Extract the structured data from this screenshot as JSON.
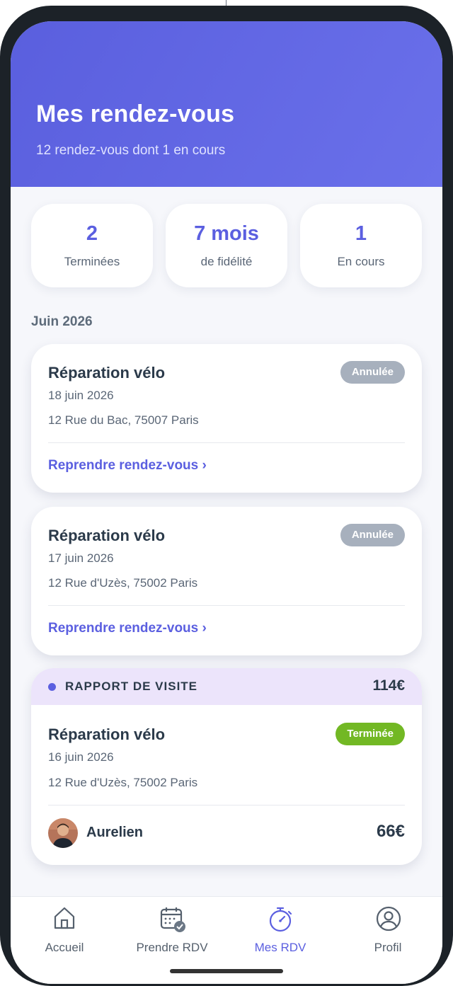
{
  "header": {
    "title": "Mes rendez-vous",
    "subtitle": "12 rendez-vous dont 1 en cours"
  },
  "stats": [
    {
      "value": "2",
      "label": "Terminées"
    },
    {
      "value": "7 mois",
      "label": "de fidélité"
    },
    {
      "value": "1",
      "label": "En cours"
    }
  ],
  "section": {
    "month": "Juin 2026"
  },
  "appointments": [
    {
      "title": "Réparation vélo",
      "date": "18 juin 2026",
      "address": "12 Rue du Bac, 75007 Paris",
      "status": "Annulée",
      "action": "Reprendre rendez-vous ›"
    },
    {
      "title": "Réparation vélo",
      "date": "17 juin 2026",
      "address": "12 Rue d'Uzès, 75002 Paris",
      "status": "Annulée",
      "action": "Reprendre rendez-vous ›"
    }
  ],
  "report": {
    "label": "RAPPORT DE VISITE",
    "total": "114€",
    "title": "Réparation vélo",
    "date": "16 juin 2026",
    "address": "12 Rue d'Uzès, 75002 Paris",
    "status": "Terminée",
    "person": "Aurelien",
    "price": "66€"
  },
  "tabs": [
    {
      "label": "Accueil",
      "icon": "home-icon"
    },
    {
      "label": "Prendre RDV",
      "icon": "calendar-check-icon"
    },
    {
      "label": "Mes RDV",
      "icon": "stopwatch-icon"
    },
    {
      "label": "Profil",
      "icon": "user-circle-icon"
    }
  ],
  "colors": {
    "accent": "#5b5fe0",
    "header_gradient_start": "#5a5fde",
    "header_gradient_end": "#6a70ea",
    "badge_cancelled": "#a7b0bd",
    "badge_done": "#72b824",
    "report_band": "#ece4fb"
  }
}
